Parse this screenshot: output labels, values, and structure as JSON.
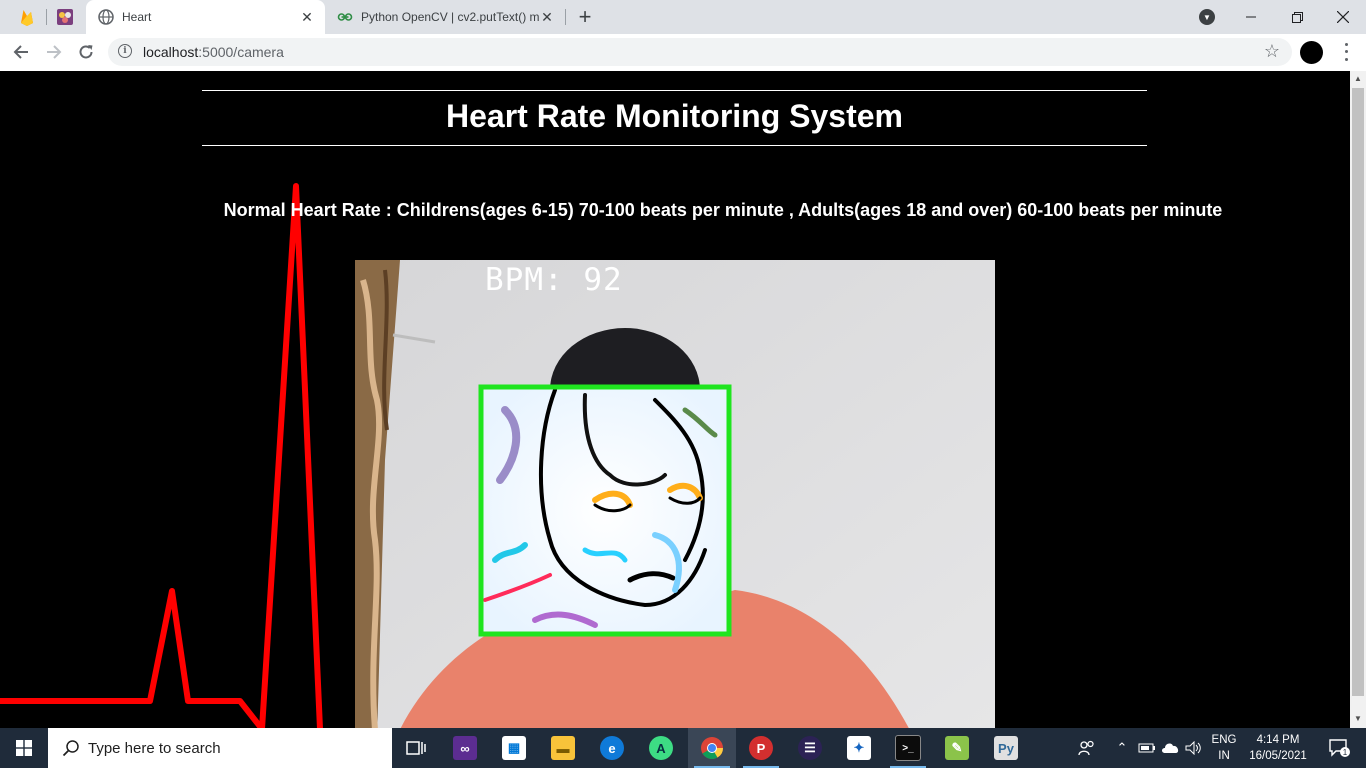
{
  "browser": {
    "tabs": [
      {
        "title": "",
        "icon": "firebase-icon"
      },
      {
        "title": "",
        "icon": "app-icon"
      },
      {
        "title": "Heart",
        "icon": "globe-icon",
        "active": true
      },
      {
        "title": "Python OpenCV | cv2.putText() m",
        "icon": "geeksforgeeks-icon",
        "active": false
      }
    ],
    "address": {
      "host": "localhost",
      "path": ":5000/camera"
    }
  },
  "page": {
    "heading": "Heart Rate Monitoring System",
    "normal_rate": "Normal Heart Rate : Childrens(ages 6-15) 70-100 beats per minute , Adults(ages 18 and over) 60-100 beats per minute",
    "camera": {
      "overlay_text": "BPM: 92",
      "box_color": "#1fe51f"
    }
  },
  "taskbar": {
    "search_placeholder": "Type here to search",
    "language": {
      "line1": "ENG",
      "line2": "IN"
    },
    "clock": {
      "time": "4:14 PM",
      "date": "16/05/2021"
    },
    "notification_count": "1"
  },
  "colors": {
    "ecg_line": "#ff0000",
    "tab_strip": "#dee1e6",
    "taskbar": "#1f2b3a"
  }
}
